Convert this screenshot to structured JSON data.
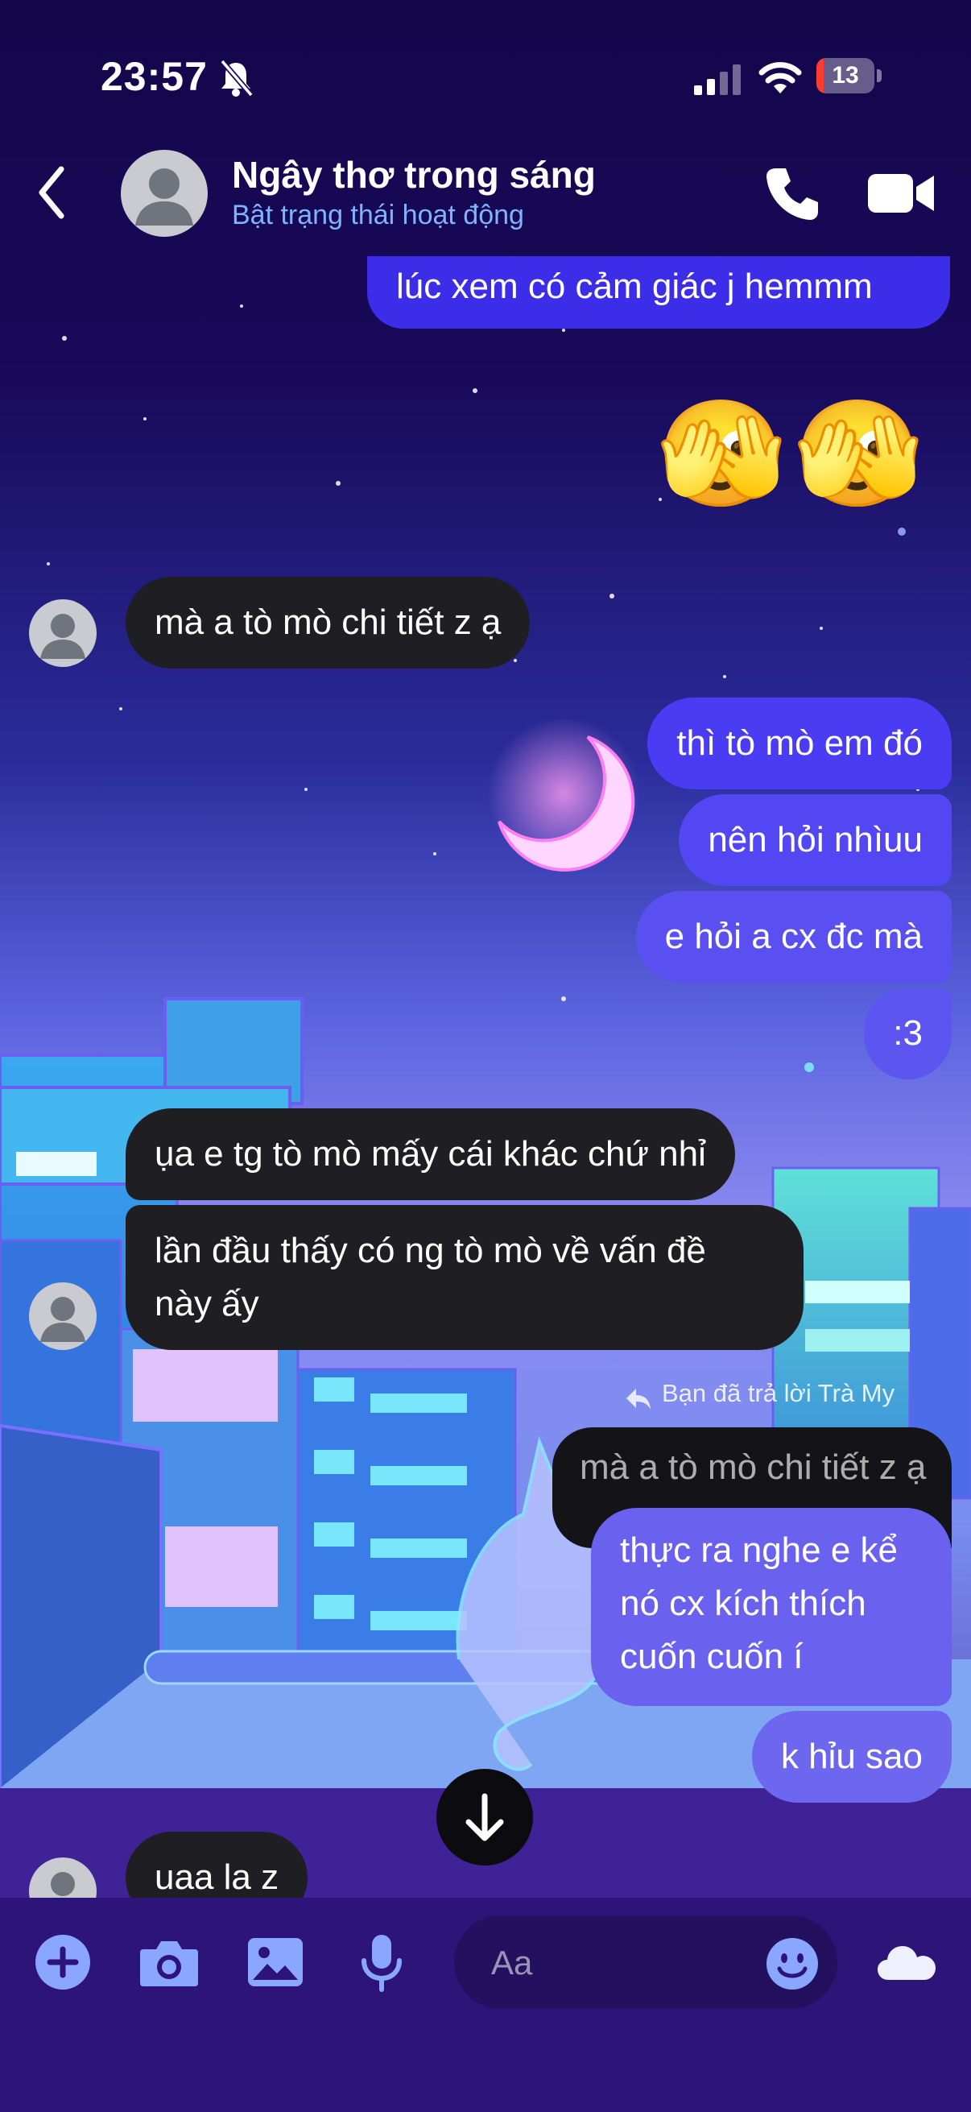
{
  "status_bar": {
    "time": "23:57",
    "battery": "13",
    "battery_level": 0.13
  },
  "header": {
    "name": "Ngây thơ trong sáng",
    "status": "Bật trạng thái hoạt động"
  },
  "messages": {
    "m1": "lúc xem có cảm giác j hemmm",
    "emojis": [
      "🫣",
      "🫣"
    ],
    "m2": "mà a tò mò chi tiết z ạ",
    "m3": "thì tò mò em đó",
    "m4": "nên hỏi nhìuu",
    "m5": "e hỏi a cx đc mà",
    "m6": ":3",
    "m7": "ụa e tg tò mò mấy cái khác chứ nhỉ",
    "m8_line1": "lần đầu thấy có ng tò mò về vấn đề",
    "m8_line2": "này ấy",
    "reply_note": "Bạn đã trả lời Trà My",
    "quoted": "mà a tò mò chi tiết z ạ",
    "m9_line1": "thực ra nghe e kể",
    "m9_line2": "nó cx kích thích",
    "m9_line3": "cuốn cuốn í",
    "m10": "k hỉu sao",
    "m11": "uaa la z"
  },
  "composer": {
    "placeholder": "Aa"
  },
  "colors": {
    "sent": "#4a3cf2",
    "sent_light": "#6a62ef",
    "received": "#1f1f23",
    "status_link": "#7fb2ff",
    "composer_bg": "#2d1478"
  }
}
